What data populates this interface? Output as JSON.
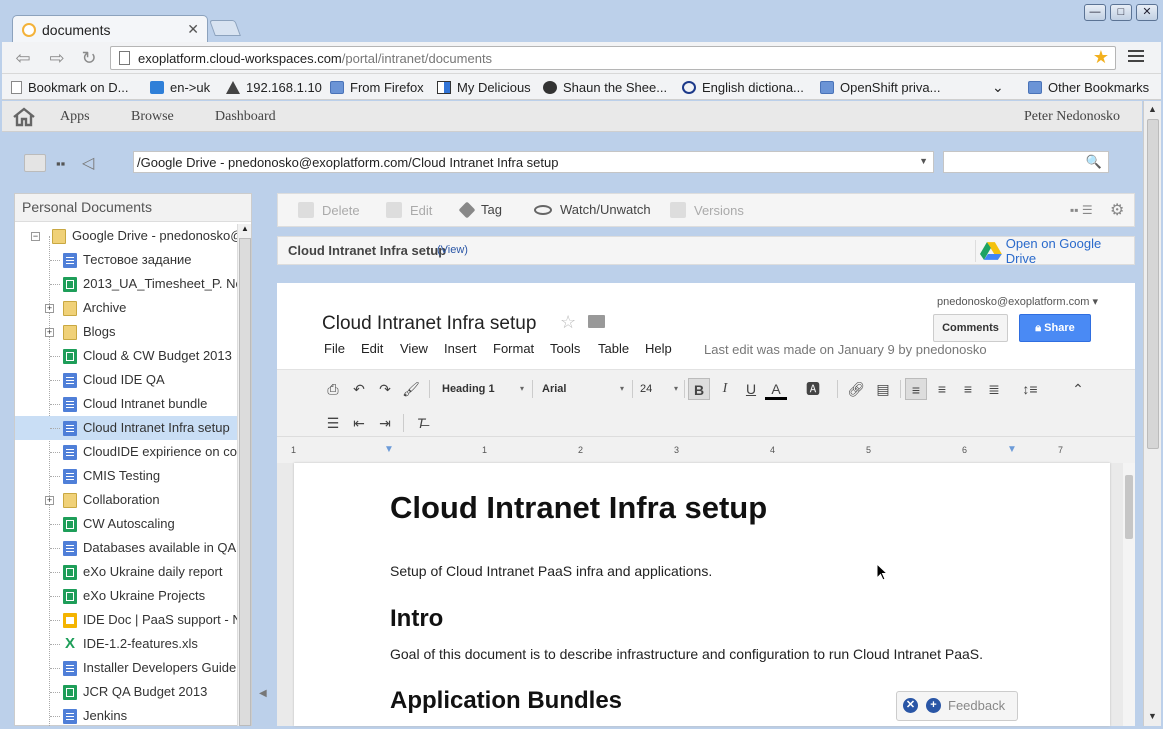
{
  "browser": {
    "tab_title": "documents",
    "url_host": "exoplatform.cloud-workspaces.com",
    "url_path": "/portal/intranet/documents",
    "bookmarks": [
      {
        "label": "Bookmark on D...",
        "icon": "page-icon"
      },
      {
        "label": "en->uk",
        "icon": "translate-icon"
      },
      {
        "label": "192.168.1.10",
        "icon": "router-icon"
      },
      {
        "label": "From Firefox",
        "icon": "folder-icon"
      },
      {
        "label": "My Delicious",
        "icon": "delicious-icon"
      },
      {
        "label": "Shaun the Shee...",
        "icon": "sheep-icon"
      },
      {
        "label": "English dictiona...",
        "icon": "dictionary-icon"
      },
      {
        "label": "OpenShift priva...",
        "icon": "folder-icon"
      }
    ],
    "other_bookmarks": "Other Bookmarks"
  },
  "nav": {
    "items": [
      "Apps",
      "Browse",
      "Dashboard"
    ],
    "user": "Peter Nedonosko"
  },
  "path": {
    "value": "/Google Drive - pnedonosko@exoplatform.com/Cloud Intranet Infra setup"
  },
  "left_panel": {
    "title": "Personal Documents",
    "items": [
      {
        "label": "Google Drive - pnedonosko@e",
        "type": "folder-open"
      },
      {
        "label": "Тестовое задание",
        "type": "doc"
      },
      {
        "label": "2013_UA_Timesheet_P. Ne",
        "type": "sheet"
      },
      {
        "label": "Archive",
        "type": "folder"
      },
      {
        "label": "Blogs",
        "type": "folder"
      },
      {
        "label": "Cloud & CW Budget 2013",
        "type": "sheet"
      },
      {
        "label": "Cloud IDE QA",
        "type": "doc"
      },
      {
        "label": "Cloud Intranet bundle",
        "type": "doc"
      },
      {
        "label": "Cloud Intranet Infra setup",
        "type": "doc",
        "selected": true
      },
      {
        "label": "CloudIDE expirience on colla",
        "type": "doc"
      },
      {
        "label": "CMIS Testing",
        "type": "doc"
      },
      {
        "label": "Collaboration",
        "type": "folder"
      },
      {
        "label": "CW Autoscaling",
        "type": "sheet"
      },
      {
        "label": "Databases available in QA U",
        "type": "doc"
      },
      {
        "label": "eXo Ukraine daily report",
        "type": "sheet"
      },
      {
        "label": "eXo Ukraine Projects",
        "type": "sheet"
      },
      {
        "label": "IDE Doc | PaaS support - No",
        "type": "slide"
      },
      {
        "label": "IDE-1.2-features.xls",
        "type": "xls"
      },
      {
        "label": "Installer Developers Guide",
        "type": "doc"
      },
      {
        "label": "JCR QA Budget 2013",
        "type": "sheet"
      },
      {
        "label": "Jenkins",
        "type": "doc"
      }
    ]
  },
  "actions": {
    "delete": "Delete",
    "edit": "Edit",
    "tag": "Tag",
    "watch": "Watch/Unwatch",
    "versions": "Versions"
  },
  "doc_header": {
    "title": "Cloud Intranet Infra setup",
    "view": "(View)",
    "open_drive": "Open on Google Drive"
  },
  "gdoc": {
    "title": "Cloud Intranet Infra setup",
    "account": "pnedonosko@exoplatform.com",
    "comments": "Comments",
    "share": "Share",
    "menus": [
      "File",
      "Edit",
      "View",
      "Insert",
      "Format",
      "Tools",
      "Table",
      "Help"
    ],
    "last_edit": "Last edit was made on January 9 by pnedonosko",
    "style": "Heading 1",
    "font": "Arial",
    "size": "24",
    "ruler": [
      "1",
      "1",
      "2",
      "3",
      "4",
      "5",
      "6",
      "7"
    ],
    "content": {
      "h1": "Cloud Intranet Infra setup",
      "p1": "Setup of Cloud Intranet PaaS infra and applications.",
      "h2a": "Intro",
      "p2": "Goal of this document is to describe infrastructure and configuration to run Cloud Intranet PaaS.",
      "h2b": "Application Bundles"
    }
  },
  "feedback": "Feedback"
}
